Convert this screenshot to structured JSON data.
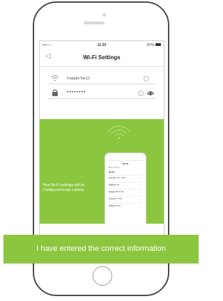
{
  "statusbar": {
    "carrier": "•••○○",
    "time": "11:35",
    "battery_text": "87%"
  },
  "navbar": {
    "title": "Wi-Fi Settings",
    "back_icon": "back-arrow-icon"
  },
  "form": {
    "ssid_value": "PaladinTek12",
    "password_value": "••••••••",
    "ssid_icon": "wifi-icon",
    "password_icon": "lock-icon",
    "clear_icon": "clear-icon",
    "show_password_icon": "eye-icon"
  },
  "panel": {
    "message": "Your Wi-Fi settings will be Configured to upi camera",
    "color": "#8cc63f"
  },
  "mini_phone": {
    "title": "WLAN",
    "subtitle": "Back     WLAN",
    "section": "WLAN",
    "networks": [
      {
        "name": "TP-LINK_5G_Y4F1",
        "sub": "Secured"
      },
      {
        "name": "ORB-R1-6G",
        "sub": "Secured"
      },
      {
        "name": "PaladinTek12 NG",
        "sub": "Secured"
      },
      {
        "name": "TP-LINK_Y4F1",
        "sub": "Secured"
      },
      {
        "name": "ORB-R1-E1G",
        "sub": "Secured"
      }
    ]
  },
  "banner": {
    "label": "I have entered the correct information",
    "color": "#8cc63f"
  }
}
